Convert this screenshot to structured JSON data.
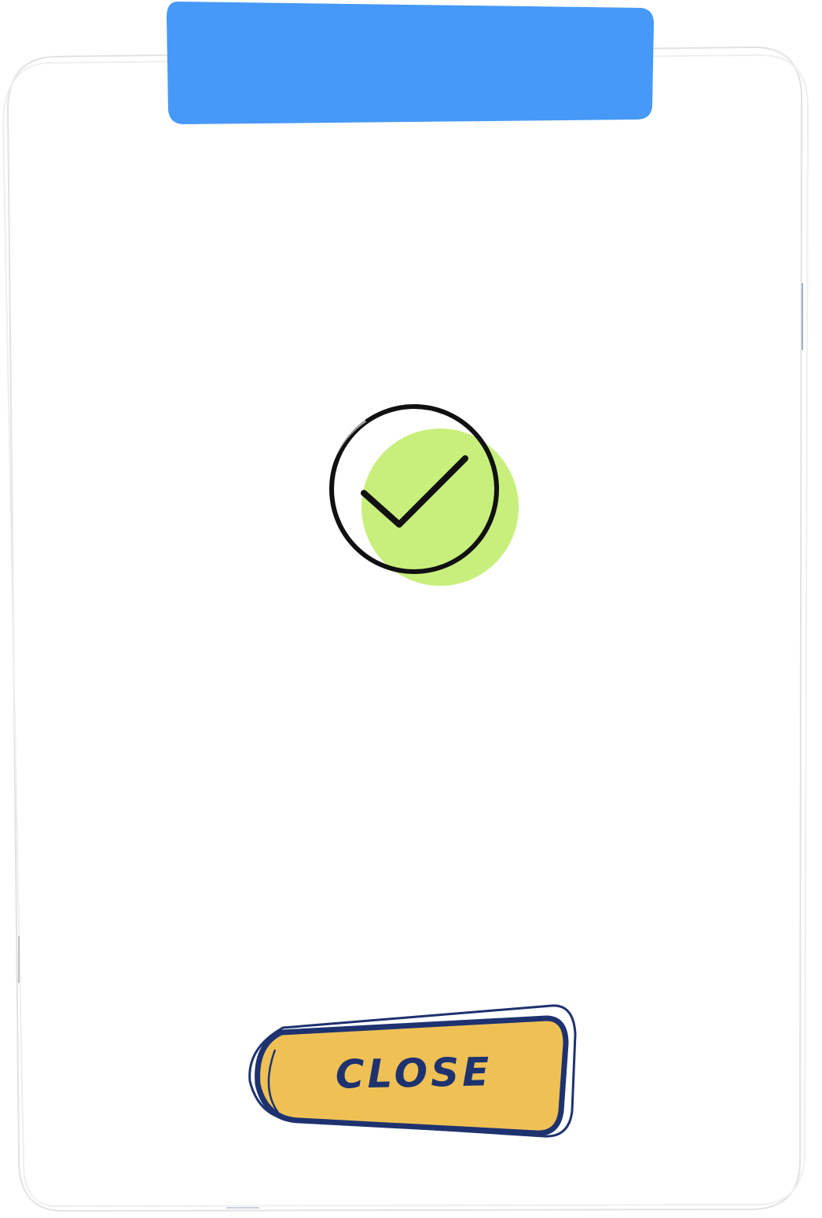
{
  "dialog": {
    "header_color": "#4699f7",
    "close_button": {
      "label": "CLOSE",
      "fill_color": "#efc155",
      "outline_color": "#1e3270"
    },
    "status": {
      "icon": "check-circle-icon",
      "fill_color": "#c8ef7c"
    }
  }
}
